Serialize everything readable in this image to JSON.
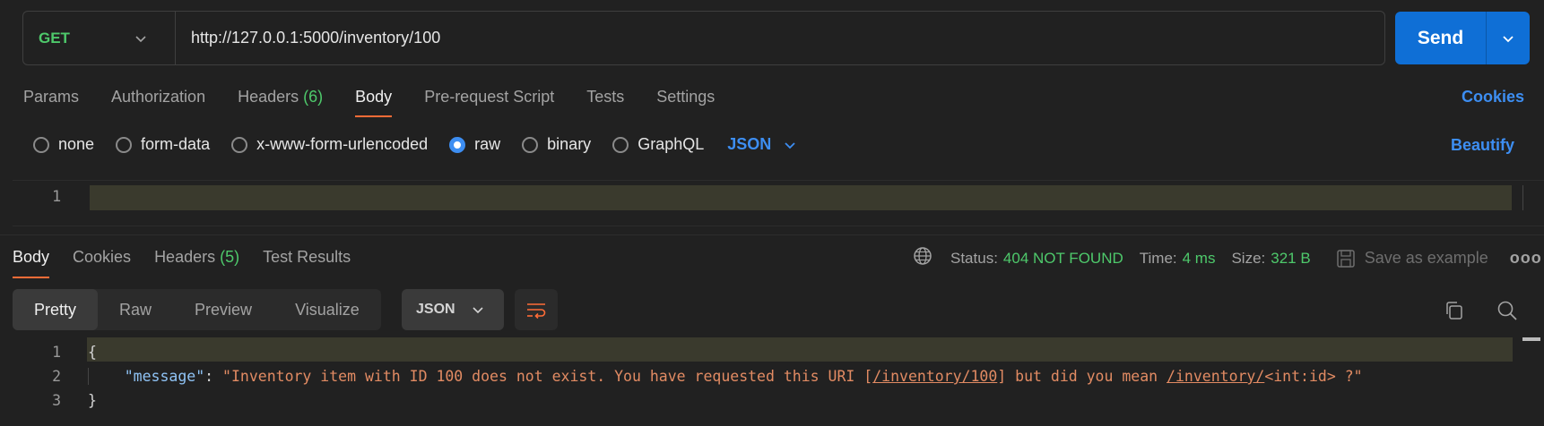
{
  "request": {
    "method": "GET",
    "url": "http://127.0.0.1:5000/inventory/100",
    "send_label": "Send"
  },
  "request_tabs": [
    {
      "label": "Params"
    },
    {
      "label": "Authorization"
    },
    {
      "label": "Headers",
      "count": "(6)"
    },
    {
      "label": "Body",
      "active": true
    },
    {
      "label": "Pre-request Script"
    },
    {
      "label": "Tests"
    },
    {
      "label": "Settings"
    }
  ],
  "cookies_label": "Cookies",
  "body_types": {
    "none": "none",
    "form_data": "form-data",
    "urlencoded": "x-www-form-urlencoded",
    "raw": "raw",
    "binary": "binary",
    "graphql": "GraphQL",
    "selected": "raw",
    "language": "JSON"
  },
  "beautify_label": "Beautify",
  "request_editor": {
    "line_number": "1"
  },
  "response_tabs": {
    "body": "Body",
    "cookies": "Cookies",
    "headers": "Headers",
    "headers_count": "(5)",
    "test_results": "Test Results"
  },
  "response_meta": {
    "status_label": "Status:",
    "status_value": "404 NOT FOUND",
    "time_label": "Time:",
    "time_value": "4 ms",
    "size_label": "Size:",
    "size_value": "321 B",
    "save_label": "Save as example",
    "more": "ooo"
  },
  "view_modes": {
    "pretty": "Pretty",
    "raw": "Raw",
    "preview": "Preview",
    "visualize": "Visualize",
    "format": "JSON"
  },
  "response_body": {
    "l1": "1",
    "l2": "2",
    "l3": "3",
    "open": "{",
    "close": "}",
    "key": "\"message\"",
    "colon": ": ",
    "str_a": "\"Inventory item with ID 100 does not exist. You have requested this URI [",
    "link1": "/inventory/100",
    "str_b": "] but did you mean ",
    "link2": "/inventory/",
    "str_c": "<int:id> ?\""
  },
  "colors": {
    "accent_blue": "#3d8ef2",
    "send_blue": "#0f6fd6",
    "success_green": "#4ec96b",
    "tab_underline": "#ff6c37",
    "string_orange": "#e28b63",
    "key_blue": "#8fc3f5"
  }
}
